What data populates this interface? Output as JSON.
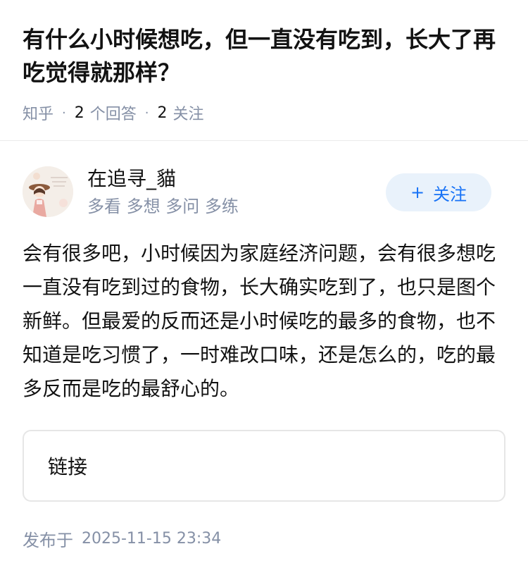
{
  "question": {
    "title": "有什么小时候想吃，但一直没有吃到，长大了再吃觉得就那样？",
    "source": "知乎",
    "answer_count": "2",
    "answer_label": "个回答",
    "follower_count": "2",
    "follower_label": "关注"
  },
  "author": {
    "name": "在追寻_貓",
    "bio": "多看 多想 多问 多练",
    "avatar_icon": "avatar-illustration-girl"
  },
  "follow_button": {
    "icon": "+",
    "label": "关注"
  },
  "answer": {
    "text": "会有很多吧，小时候因为家庭经济问题，会有很多想吃一直没有吃到过的食物，长大确实吃到了，也只是图个新鲜。但最爱的反而还是小时候吃的最多的食物，也不知道是吃习惯了，一时难改口味，还是怎么的，吃的最多反而是吃的最舒心的。"
  },
  "link_card": {
    "label": "链接"
  },
  "publish": {
    "label": "发布于",
    "time": "2025-11-15 23:34"
  },
  "colors": {
    "accent": "#1772f6",
    "follow_bg": "#e9f2fb",
    "muted_text": "#8590a6",
    "divider": "#ebebeb"
  }
}
